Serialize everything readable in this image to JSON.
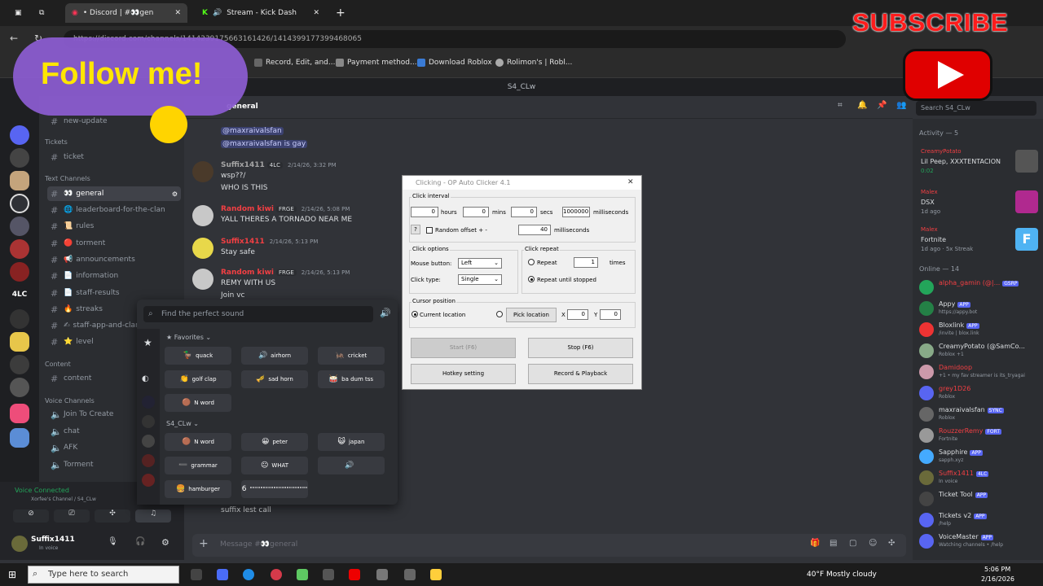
{
  "browser": {
    "tabs": [
      {
        "label": "• Discord | #👀gen"
      },
      {
        "label": "Stream - Kick Dash"
      }
    ],
    "url": "https://discord.com/channels/1414239175663161426/1414399177399468065",
    "bookmarks": [
      "Record, Edit, and...",
      "Payment method...",
      "Download Roblox",
      "Rolimon's | Robl..."
    ]
  },
  "overlay": {
    "follow_text": "Follow me!",
    "subscribe_text": "SUBSCRIBE"
  },
  "discord": {
    "server_title": "S4_CLw",
    "current_channel": "general",
    "channels_partial": "new-update",
    "categories": {
      "tickets": "Tickets",
      "text": "Text Channels",
      "content": "Content",
      "voice": "Voice Channels"
    },
    "channels": [
      {
        "name": "ticket",
        "emoji": ""
      },
      {
        "name": "general",
        "emoji": "👀"
      },
      {
        "name": "leaderboard-for-the-clan",
        "emoji": "🌐"
      },
      {
        "name": "rules",
        "emoji": "📜"
      },
      {
        "name": "torment",
        "emoji": "🔴"
      },
      {
        "name": "announcements",
        "emoji": "📢"
      },
      {
        "name": "information",
        "emoji": "📄"
      },
      {
        "name": "staff-results",
        "emoji": "📄"
      },
      {
        "name": "streaks",
        "emoji": "🔥"
      },
      {
        "name": "staff-app-and-clan",
        "emoji": "✍"
      },
      {
        "name": "level",
        "emoji": "⭐"
      }
    ],
    "content_channel": "content",
    "voice_channels": [
      {
        "name": "Join To Create"
      },
      {
        "name": "chat"
      },
      {
        "name": "AFK"
      },
      {
        "name": "Torment"
      }
    ],
    "voice_connected": "Voice Connected",
    "voice_channel_path": "Xorfee's Channel / S4_CLw",
    "user": {
      "name": "Suffix1411",
      "status": "In voice"
    },
    "messages": [
      {
        "user": "",
        "text": "@maxraivalsfan",
        "time": "",
        "mention": true
      },
      {
        "user": "",
        "text": "@maxraivalsfan  is gay",
        "time": "",
        "mention": true
      },
      {
        "user": "Suffix1411",
        "tag": "4LC",
        "time": "2/14/26, 3:32 PM",
        "lines": [
          "wsp??/",
          "WHO IS THIS"
        ]
      },
      {
        "user": "Random kiwi",
        "tag": "FRGE",
        "time": "2/14/26, 5:08 PM",
        "lines": [
          "YALL THERES A TORNADO NEAR ME"
        ]
      },
      {
        "user": "Suffix1411",
        "tag": "",
        "time": "2/14/26, 5:13 PM",
        "lines": [
          "Stay safe"
        ]
      },
      {
        "user": "Random kiwi",
        "tag": "FRGE",
        "time": "2/14/26, 5:13 PM",
        "lines": [
          "REMY WITH US",
          "Join vc"
        ]
      },
      {
        "user": "",
        "time": "",
        "lines": [
          "suffix lest call"
        ]
      }
    ],
    "message_placeholder": "Message #👀general",
    "search_placeholder": "Search S4_CLw",
    "activity_header": "Activity — 5",
    "activities": [
      {
        "user": "CreamyPotato",
        "title": "Lil Peep, XXXTENTACION",
        "sub": "0:02"
      },
      {
        "user": "Malex",
        "title": "DSX",
        "sub": "1d ago"
      },
      {
        "user": "Malex",
        "title": "Fortnite",
        "sub": "1d ago · 5x Streak"
      }
    ],
    "online_header": "Online — 14",
    "members": [
      {
        "name": "alpha_gamin (@|...",
        "badge": "GSRP",
        "status": "",
        "color": "#f23f43"
      },
      {
        "name": "Appy",
        "badge": "APP",
        "status": "https://appy.bot",
        "color": "#dbdee1"
      },
      {
        "name": "Bloxlink",
        "badge": "APP",
        "status": "/invite | blox.link",
        "color": "#dbdee1"
      },
      {
        "name": "CreamyPotato (@SamCo...",
        "badge": "",
        "status": "Roblox +1",
        "color": "#dbdee1"
      },
      {
        "name": "Damidoop",
        "badge": "",
        "status": "+1 • my fav streamer is its_tryagai",
        "color": "#f23f43"
      },
      {
        "name": "grey1D26",
        "badge": "",
        "status": "Roblox",
        "color": "#f23f43"
      },
      {
        "name": "maxraivalsfan",
        "badge": "SYNC",
        "status": "Roblox",
        "color": "#dbdee1"
      },
      {
        "name": "RouzzerRemy",
        "badge": "FORT",
        "status": "Fortnite",
        "color": "#f23f43"
      },
      {
        "name": "Sapphire",
        "badge": "APP",
        "status": "sapph.xyz",
        "color": "#dbdee1"
      },
      {
        "name": "Suffix1411",
        "badge": "4LC",
        "status": "In voice",
        "color": "#f23f43"
      },
      {
        "name": "Ticket Tool",
        "badge": "APP",
        "status": "",
        "color": "#dbdee1"
      },
      {
        "name": "Tickets v2",
        "badge": "APP",
        "status": "/help",
        "color": "#dbdee1"
      },
      {
        "name": "VoiceMaster",
        "badge": "APP",
        "status": "Watching channels • /help",
        "color": "#dbdee1"
      }
    ]
  },
  "soundboard": {
    "search_placeholder": "Find the perfect sound",
    "favorites_label": "Favorites",
    "server_label": "S4_CLw",
    "favorites": [
      {
        "name": "quack",
        "emoji": "🦆"
      },
      {
        "name": "airhorn",
        "emoji": "🔊"
      },
      {
        "name": "cricket",
        "emoji": "🦗"
      },
      {
        "name": "golf clap",
        "emoji": "👏"
      },
      {
        "name": "sad horn",
        "emoji": "🎺"
      },
      {
        "name": "ba dum tss",
        "emoji": "🥁"
      },
      {
        "name": "N word",
        "emoji": "🟤"
      }
    ],
    "server_sounds": [
      {
        "name": "N word",
        "emoji": "🟤"
      },
      {
        "name": "peter",
        "emoji": "😀"
      },
      {
        "name": "japan",
        "emoji": "😺"
      },
      {
        "name": "grammar",
        "emoji": "➖"
      },
      {
        "name": "WHAT",
        "emoji": "😐"
      },
      {
        "name": "",
        "emoji": "🔊"
      },
      {
        "name": "hamburger",
        "emoji": "🍔"
      },
      {
        "name": "\"\"\"\"\"\"\"\"\"\"\"\"\"\"\"\"\"\"\"\"\"\"",
        "emoji": "6"
      }
    ]
  },
  "autoclicker": {
    "title": "Clicking - OP Auto Clicker 4.1",
    "click_interval_label": "Click interval",
    "hours_value": "0",
    "hours_label": "hours",
    "mins_value": "0",
    "mins_label": "mins",
    "secs_value": "0",
    "secs_label": "secs",
    "ms_value": "1000000",
    "ms_label": "milliseconds",
    "random_offset_label": "Random offset + -",
    "random_offset_value": "40",
    "random_offset_unit": "milliseconds",
    "click_options_label": "Click options",
    "mouse_button_label": "Mouse button:",
    "mouse_button_value": "Left",
    "click_type_label": "Click type:",
    "click_type_value": "Single",
    "click_repeat_label": "Click repeat",
    "repeat_label": "Repeat",
    "repeat_value": "1",
    "times_label": "times",
    "repeat_until_label": "Repeat until stopped",
    "cursor_position_label": "Cursor position",
    "current_location_label": "Current location",
    "pick_location_label": "Pick location",
    "x_label": "X",
    "x_value": "0",
    "y_label": "Y",
    "y_value": "0",
    "start_label": "Start (F6)",
    "stop_label": "Stop (F6)",
    "hotkey_label": "Hotkey setting",
    "record_label": "Record & Playback"
  },
  "taskbar": {
    "search_placeholder": "Type here to search",
    "weather": "40°F  Mostly cloudy",
    "time": "5:06 PM",
    "date": "2/16/2026"
  }
}
